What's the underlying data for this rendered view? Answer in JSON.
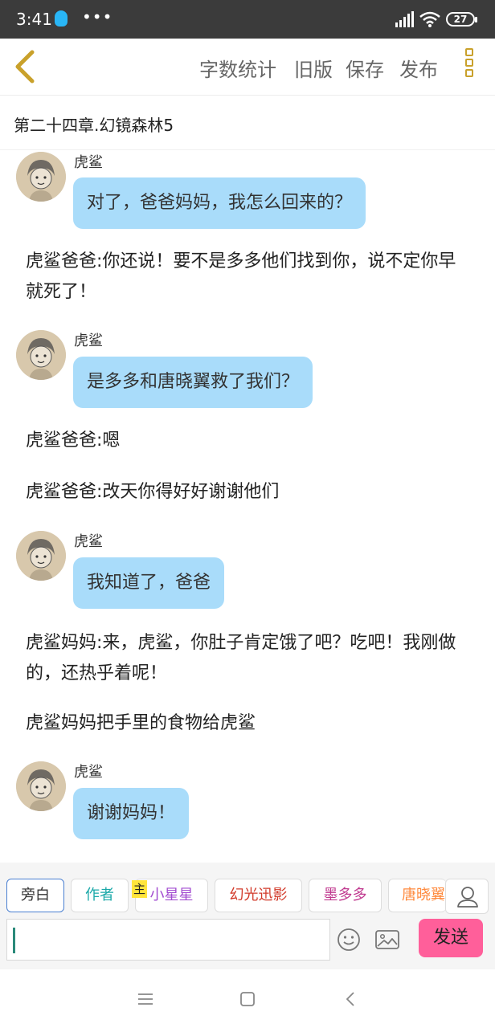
{
  "status": {
    "time": "3:41",
    "dots": "•••",
    "battery": "27"
  },
  "toolbar": {
    "word_count": "字数统计",
    "old_version": "旧版",
    "save": "保存",
    "publish": "发布"
  },
  "chapter_title": "第二十四章.幻镜森林5",
  "messages": [
    {
      "sender": "虎鲨",
      "text": "对了，爸爸妈妈，我怎么回来的？"
    },
    {
      "narration": "虎鲨爸爸:你还说！要不是多多他们找到你，说不定你早就死了！"
    },
    {
      "sender": "虎鲨",
      "text": "是多多和唐晓翼救了我们？"
    },
    {
      "narration": "虎鲨爸爸:嗯"
    },
    {
      "narration": "虎鲨爸爸:改天你得好好谢谢他们"
    },
    {
      "sender": "虎鲨",
      "text": "我知道了，爸爸"
    },
    {
      "narration": "虎鲨妈妈:来，虎鲨，你肚子肯定饿了吧？吃吧！我刚做的，还热乎着呢！"
    },
    {
      "narration": "虎鲨妈妈把手里的食物给虎鲨"
    },
    {
      "sender": "虎鲨",
      "text": "谢谢妈妈！"
    }
  ],
  "characters": [
    {
      "name": "旁白",
      "color": "#333333"
    },
    {
      "name": "作者",
      "color": "#1aa8a8"
    },
    {
      "name": "小星星",
      "color": "#a24bd0",
      "badge": "主"
    },
    {
      "name": "幻光迅影",
      "color": "#d23a2a"
    },
    {
      "name": "墨多多",
      "color": "#c0398f"
    },
    {
      "name": "唐晓翼",
      "color": "#ff8a3d"
    }
  ],
  "composer": {
    "send": "发送"
  },
  "colors": {
    "bubble": "#a9dcfa",
    "send_button": "#ff5f9a",
    "accent_gold": "#c9a12b",
    "selected_border": "#4a7fd1"
  }
}
